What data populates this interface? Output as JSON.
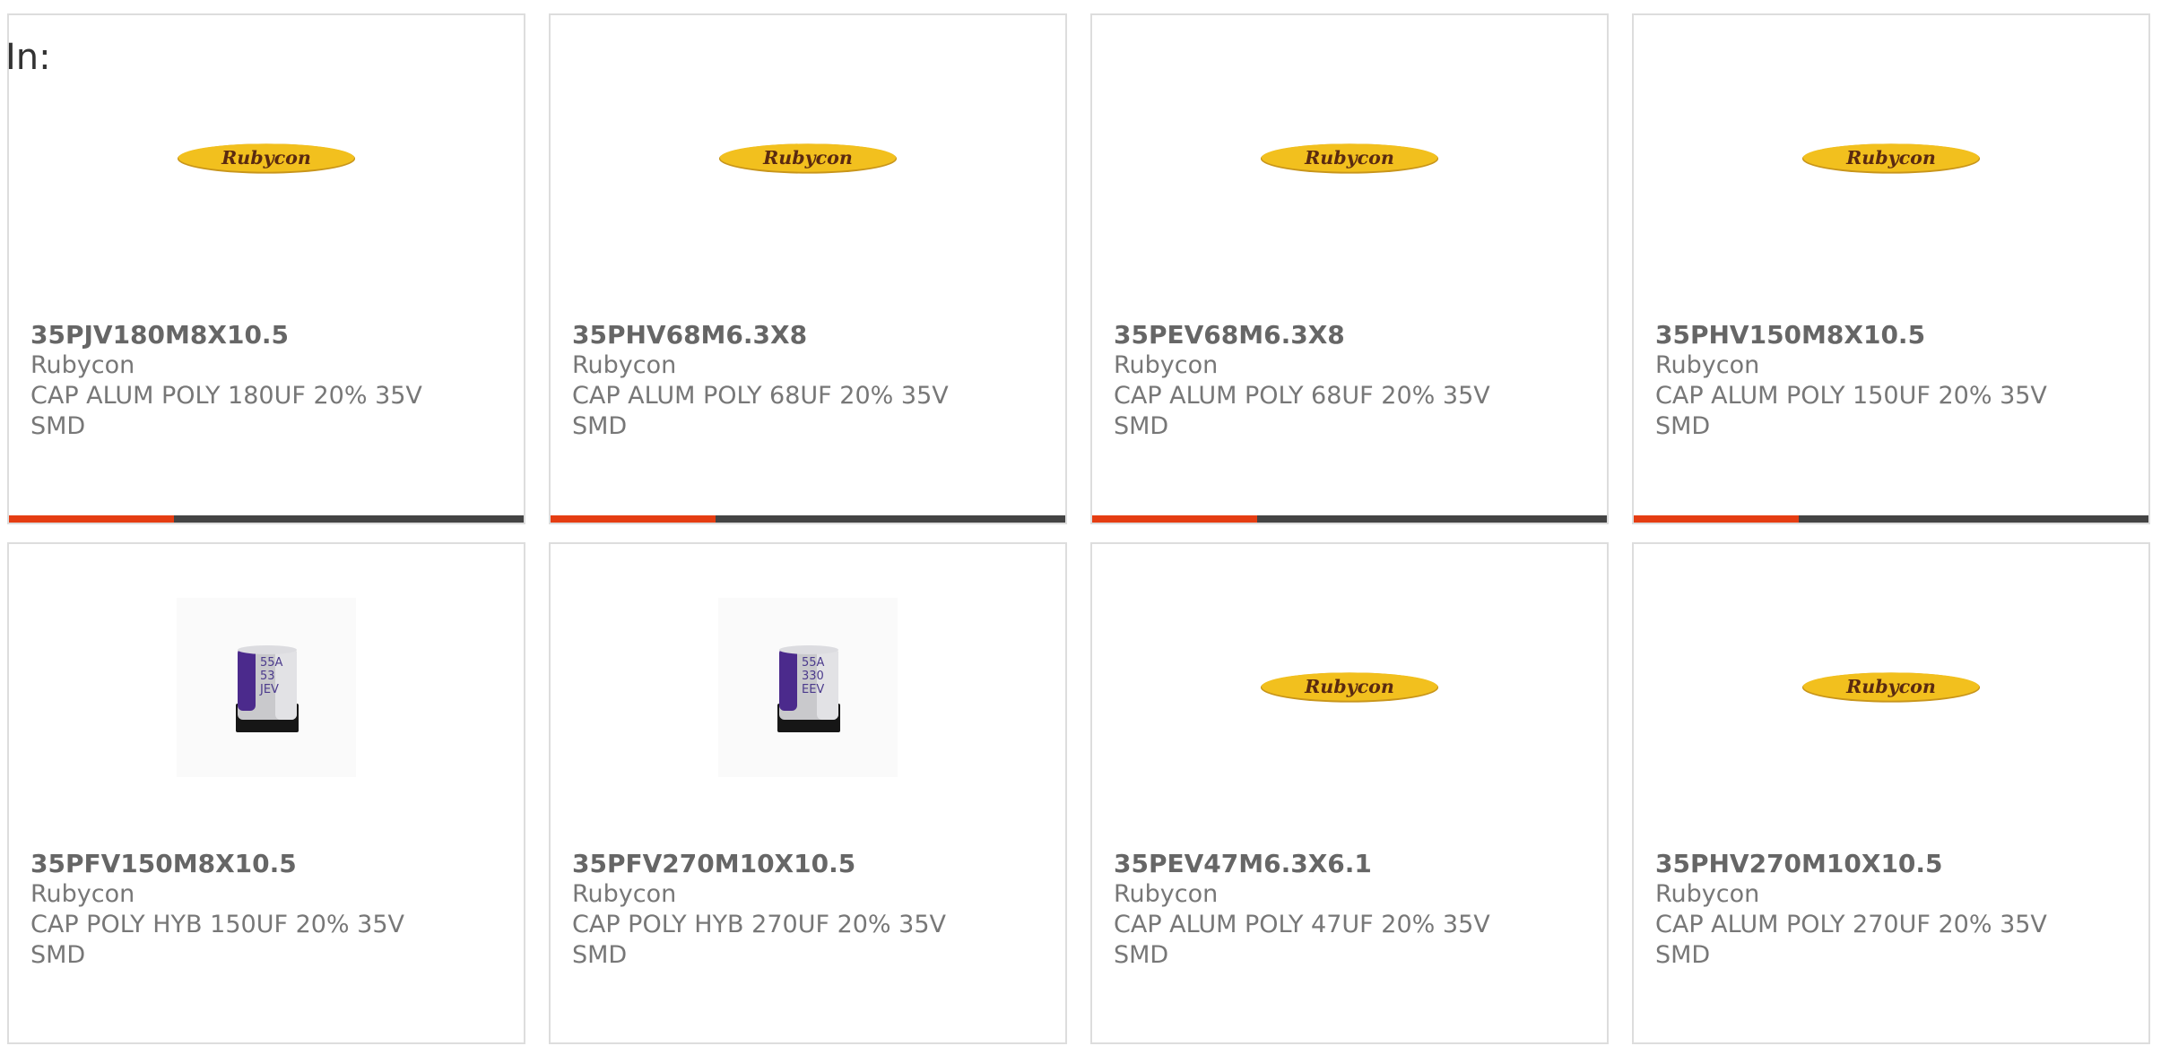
{
  "page": {
    "label": "In:"
  },
  "colors": {
    "progress_fill": "#e53d12",
    "progress_track": "#444444",
    "card_border": "#dddddd",
    "logo_yellow": "#f2c01e",
    "logo_text": "#5a2a10"
  },
  "cards": [
    {
      "part_number": "35PJV180M8X10.5",
      "manufacturer": "Rubycon",
      "description": "CAP ALUM POLY 180UF 20% 35V",
      "package": "SMD",
      "image": "rubycon-logo",
      "logo_text": "Rubycon",
      "progress": 0.32
    },
    {
      "part_number": "35PHV68M6.3X8",
      "manufacturer": "Rubycon",
      "description": "CAP ALUM POLY 68UF 20% 35V",
      "package": "SMD",
      "image": "rubycon-logo",
      "logo_text": "Rubycon",
      "progress": 0.32
    },
    {
      "part_number": "35PEV68M6.3X8",
      "manufacturer": "Rubycon",
      "description": "CAP ALUM POLY 68UF 20% 35V",
      "package": "SMD",
      "image": "rubycon-logo",
      "logo_text": "Rubycon",
      "progress": 0.32
    },
    {
      "part_number": "35PHV150M8X10.5",
      "manufacturer": "Rubycon",
      "description": "CAP ALUM POLY 150UF 20% 35V",
      "package": "SMD",
      "image": "rubycon-logo",
      "logo_text": "Rubycon",
      "progress": 0.32
    },
    {
      "part_number": "35PFV150M8X10.5",
      "manufacturer": "Rubycon",
      "description": "CAP POLY HYB 150UF 20% 35V",
      "package": "SMD",
      "image": "capacitor-photo",
      "cap_marking": [
        "55A",
        "53",
        "JEV"
      ]
    },
    {
      "part_number": "35PFV270M10X10.5",
      "manufacturer": "Rubycon",
      "description": "CAP POLY HYB 270UF 20% 35V",
      "package": "SMD",
      "image": "capacitor-photo",
      "cap_marking": [
        "55A",
        "330",
        "EEV"
      ]
    },
    {
      "part_number": "35PEV47M6.3X6.1",
      "manufacturer": "Rubycon",
      "description": "CAP ALUM POLY 47UF 20% 35V",
      "package": "SMD",
      "image": "rubycon-logo",
      "logo_text": "Rubycon"
    },
    {
      "part_number": "35PHV270M10X10.5",
      "manufacturer": "Rubycon",
      "description": "CAP ALUM POLY 270UF 20% 35V",
      "package": "SMD",
      "image": "rubycon-logo",
      "logo_text": "Rubycon"
    }
  ]
}
